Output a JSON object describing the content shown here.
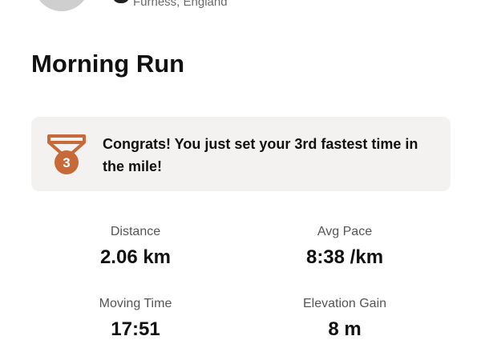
{
  "header": {
    "location": "Furness, England"
  },
  "activity": {
    "title": "Morning Run"
  },
  "achievement": {
    "rank": "3",
    "message": "Congrats! You just set your 3rd fastest time in the mile!",
    "medal_color": "#c8693a"
  },
  "stats": [
    {
      "label": "Distance",
      "value": "2.06 km"
    },
    {
      "label": "Avg Pace",
      "value": "8:38 /km"
    },
    {
      "label": "Moving Time",
      "value": "17:51"
    },
    {
      "label": "Elevation Gain",
      "value": "8 m"
    }
  ]
}
